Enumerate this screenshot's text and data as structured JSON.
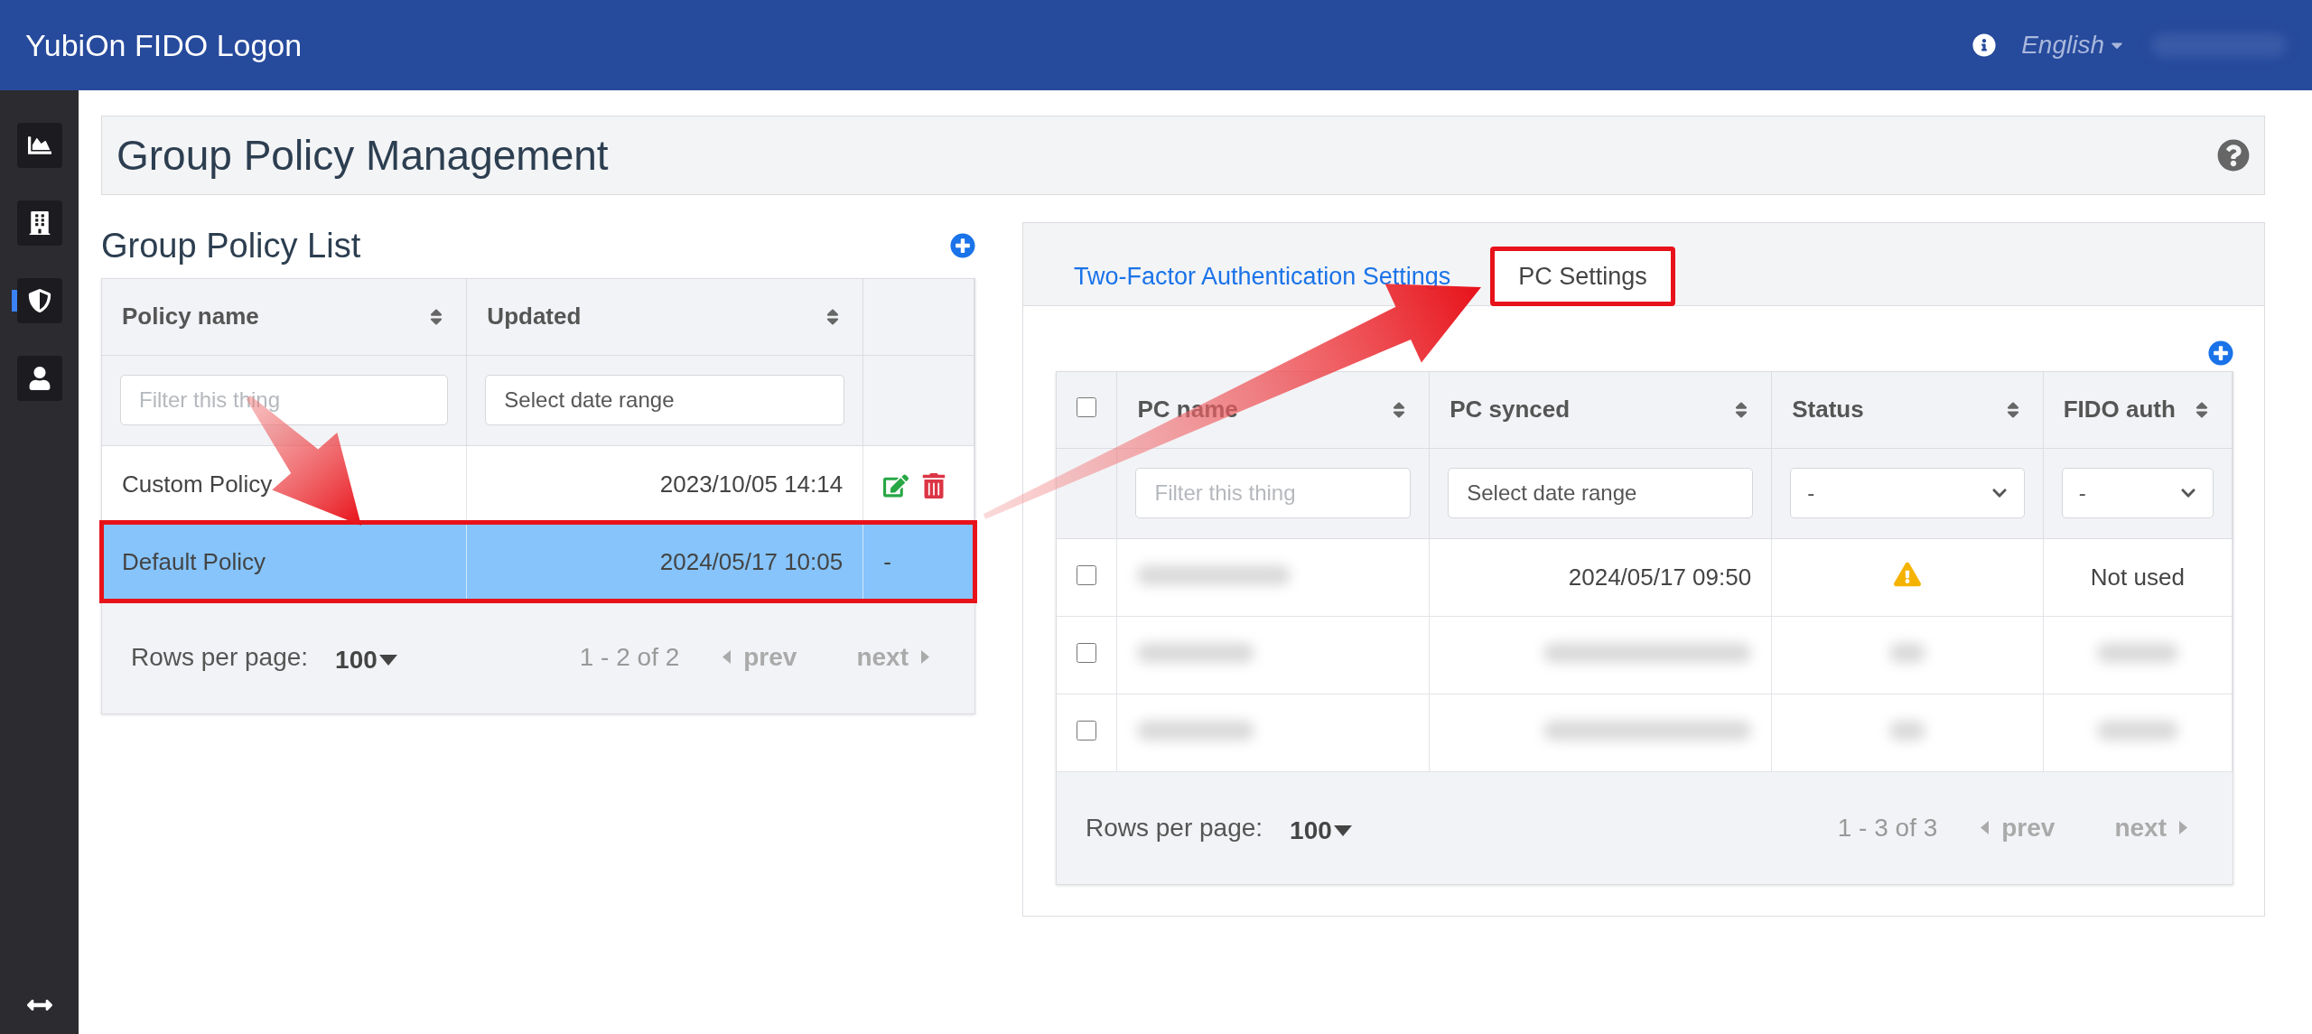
{
  "app_title": "YubiOn FIDO Logon",
  "top_bar": {
    "language": "English"
  },
  "sidebar": {
    "items": [
      {
        "kind": "chart",
        "selected": false
      },
      {
        "kind": "building",
        "selected": false
      },
      {
        "kind": "shield",
        "selected": true
      },
      {
        "kind": "user",
        "selected": false
      }
    ]
  },
  "page_title": "Group Policy Management",
  "policy_list": {
    "title": "Group Policy List",
    "columns": [
      {
        "label": "Policy name"
      },
      {
        "label": "Updated"
      }
    ],
    "filters": [
      {
        "kind": "text",
        "placeholder": "Filter this thing"
      },
      {
        "kind": "date",
        "placeholder": "Select date range"
      }
    ],
    "rows": [
      {
        "name": "Custom Policy",
        "updated": "2023/10/05 14:14",
        "selected": false,
        "highlighted": false,
        "actions": [
          {
            "kind": "edit"
          },
          {
            "kind": "delete"
          }
        ]
      },
      {
        "name": "Default Policy",
        "updated": "2024/05/17 10:05",
        "selected": true,
        "highlighted": true,
        "action_text": "-"
      }
    ],
    "footer": {
      "rows_label": "Rows per page:",
      "rows_value": "100",
      "range": "1 - 2 of 2",
      "prev": "prev",
      "next": "next"
    }
  },
  "settings": {
    "tabs": [
      {
        "label": "Two-Factor Authentication Settings",
        "selected": false,
        "highlighted": false
      },
      {
        "label": "PC Settings",
        "selected": true,
        "highlighted": true
      }
    ],
    "table": {
      "select_all_checked": false,
      "columns": [
        {
          "label": "PC name"
        },
        {
          "label": "PC synced"
        },
        {
          "label": "Status"
        },
        {
          "label": "FIDO auth"
        }
      ],
      "filters": [
        {
          "kind": "text",
          "placeholder": "Filter this thing"
        },
        {
          "kind": "date",
          "placeholder": "Select date range"
        },
        {
          "kind": "select",
          "value": "-"
        },
        {
          "kind": "select",
          "value": "-"
        }
      ],
      "rows": [
        {
          "checked": false,
          "redacted": false,
          "synced": "2024/05/17 09:50",
          "status": {
            "kind": "warning"
          },
          "fido_auth": "Not used"
        },
        {
          "checked": false,
          "redacted": true
        },
        {
          "checked": false,
          "redacted": true
        }
      ],
      "footer": {
        "rows_label": "Rows per page:",
        "rows_value": "100",
        "range": "1 - 3 of 3",
        "prev": "prev",
        "next": "next"
      }
    }
  }
}
